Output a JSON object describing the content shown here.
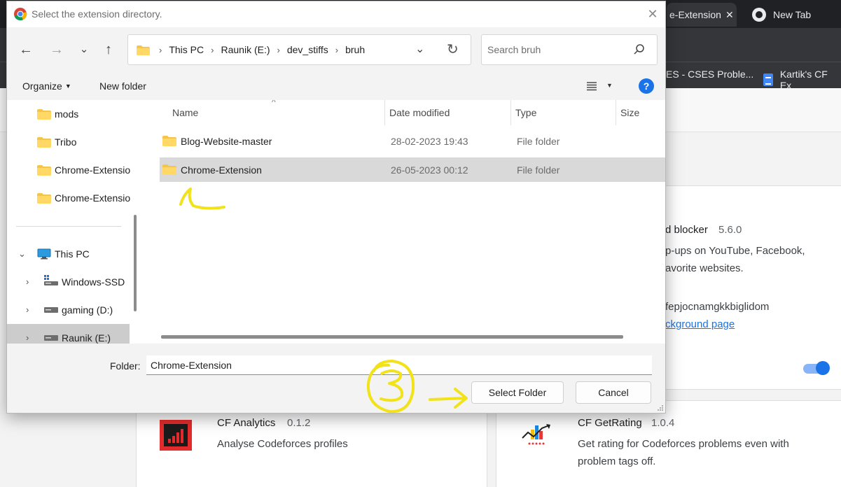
{
  "browser": {
    "tabs": [
      {
        "label": "e-Extension"
      },
      {
        "label": "New Tab"
      }
    ],
    "bookmarks": [
      {
        "label": "ES - CSES Proble..."
      },
      {
        "label": "Kartik's CF Ex"
      }
    ],
    "extensions": {
      "adblock": {
        "name_fragment": "d blocker",
        "version": "5.6.0",
        "desc_line1": "p-ups on YouTube, Facebook,",
        "desc_line2": "avorite websites.",
        "id_fragment": "fepjocnamgkkbiglidom",
        "link_fragment": "ckground page"
      },
      "cf_analytics": {
        "name": "CF Analytics",
        "version": "0.1.2",
        "description": "Analyse Codeforces profiles"
      },
      "cf_getrating": {
        "name": "CF GetRating",
        "version": "1.0.4",
        "desc_line1": "Get rating for Codeforces problems even with",
        "desc_line2": "problem tags off."
      }
    }
  },
  "dialog": {
    "title": "Select the extension directory.",
    "breadcrumbs": [
      "This PC",
      "Raunik (E:)",
      "dev_stiffs",
      "bruh"
    ],
    "search_placeholder": "Search bruh",
    "organize_label": "Organize",
    "new_folder_label": "New folder",
    "help_symbol": "?",
    "sidebar": {
      "quick_access": [
        "mods",
        "Tribo",
        "Chrome-Extensio",
        "Chrome-Extensio"
      ],
      "this_pc": "This PC",
      "drives": [
        "Windows-SSD",
        "gaming (D:)",
        "Raunik (E:)"
      ]
    },
    "columns": {
      "name": "Name",
      "date": "Date modified",
      "type": "Type",
      "size": "Size"
    },
    "files": [
      {
        "name": "Blog-Website-master",
        "date": "28-02-2023 19:43",
        "type": "File folder"
      },
      {
        "name": "Chrome-Extension",
        "date": "26-05-2023 00:12",
        "type": "File folder"
      }
    ],
    "folder_label": "Folder:",
    "folder_value": "Chrome-Extension",
    "select_button": "Select Folder",
    "cancel_button": "Cancel"
  },
  "colors": {
    "annotation": "#f2e21a",
    "accent": "#1a73e8",
    "folder": "#f4c44b"
  }
}
